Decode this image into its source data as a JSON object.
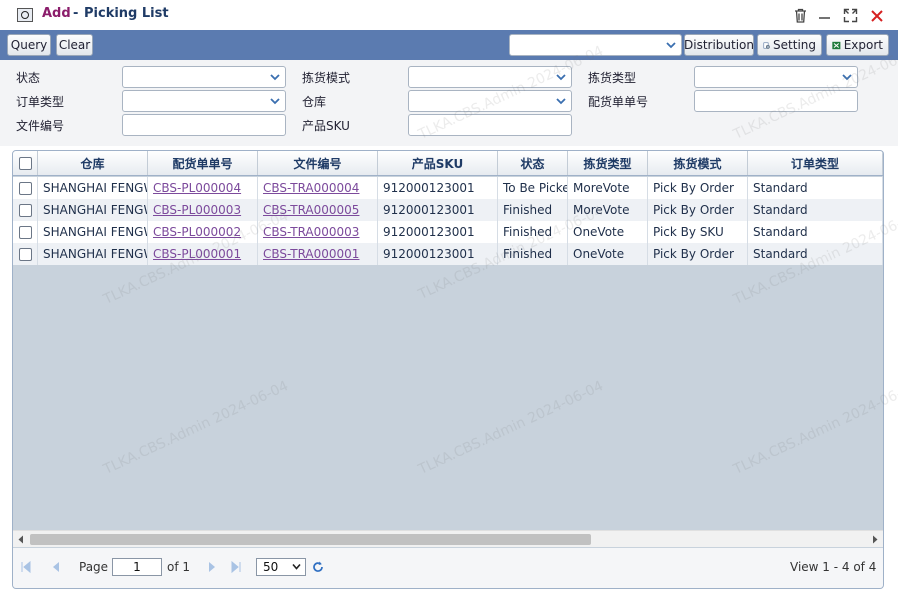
{
  "window": {
    "title_action": "Add",
    "title_separator": "-",
    "title": "Picking List",
    "buttons": [
      "trash-icon",
      "minimize-icon",
      "maximize-icon",
      "close-icon"
    ]
  },
  "toolbar": {
    "query_label": "Query",
    "clear_label": "Clear",
    "distribution_value": "",
    "distribution_label": "Distribution",
    "setting_label": "Setting",
    "export_label": "Export"
  },
  "filters": {
    "status_label": "状态",
    "order_type_label": "订单类型",
    "file_no_label": "文件编号",
    "picking_mode_label": "拣货模式",
    "warehouse_label": "仓库",
    "product_sku_label": "产品SKU",
    "picking_type_label": "拣货类型",
    "distribution_no_label": "配货单单号",
    "status_value": "",
    "order_type_value": "",
    "file_no_value": "",
    "picking_mode_value": "",
    "warehouse_value": "",
    "product_sku_value": "",
    "picking_type_value": "",
    "distribution_no_value": ""
  },
  "table": {
    "columns": [
      "仓库",
      "配货单单号",
      "文件编号",
      "产品SKU",
      "状态",
      "拣货类型",
      "拣货模式",
      "订单类型"
    ],
    "rows": [
      {
        "warehouse": "SHANGHAI FENGWEI",
        "distribution_no": "CBS-PL000004",
        "file_no": "CBS-TRA000004",
        "sku": "912000123001",
        "status": "To Be Picked",
        "picking_type": "MoreVote",
        "picking_mode": "Pick By Order",
        "order_type": "Standard"
      },
      {
        "warehouse": "SHANGHAI FENGWEI",
        "distribution_no": "CBS-PL000003",
        "file_no": "CBS-TRA000005",
        "sku": "912000123001",
        "status": "Finished",
        "picking_type": "MoreVote",
        "picking_mode": "Pick By Order",
        "order_type": "Standard"
      },
      {
        "warehouse": "SHANGHAI FENGWEI",
        "distribution_no": "CBS-PL000002",
        "file_no": "CBS-TRA000003",
        "sku": "912000123001",
        "status": "Finished",
        "picking_type": "OneVote",
        "picking_mode": "Pick By SKU",
        "order_type": "Standard"
      },
      {
        "warehouse": "SHANGHAI FENGWEI",
        "distribution_no": "CBS-PL000001",
        "file_no": "CBS-TRA000001",
        "sku": "912000123001",
        "status": "Finished",
        "picking_type": "OneVote",
        "picking_mode": "Pick By Order",
        "order_type": "Standard"
      }
    ]
  },
  "pager": {
    "page_label": "Page",
    "page_value": "1",
    "of_label": "of 1",
    "page_size": "50",
    "view_text": "View 1 - 4 of 4"
  },
  "watermark": "TLKA.CBS.Admin 2024-06-04",
  "colors": {
    "toolbar_bg": "#5b7bb0",
    "title_action": "#8b1d6b",
    "link": "#7c4a9c",
    "close": "#d62020"
  }
}
